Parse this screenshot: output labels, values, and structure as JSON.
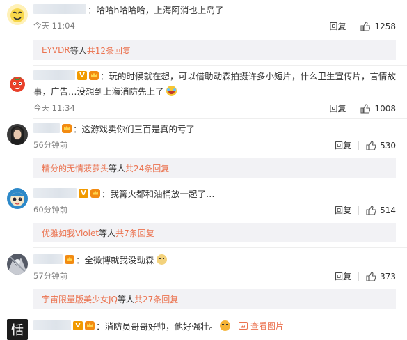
{
  "comments": [
    {
      "text": "：哈哈h哈哈哈，上海阿消也上岛了",
      "time": "今天 11:04",
      "reply_label": "回复",
      "likes": "1258",
      "sub": {
        "user": "EYVDR",
        "mid": " 等人 ",
        "count": "共12条回复"
      }
    },
    {
      "text": "：玩的时候就在想，可以借助动森拍摄许多小短片，什么卫生宣传片，言情故",
      "text2": "事，广告…没想到上海消防先上了",
      "time": "今天 11:34",
      "reply_label": "回复",
      "likes": "1008"
    },
    {
      "text": "：这游戏卖你们三百是真的亏了",
      "time": "56分钟前",
      "reply_label": "回复",
      "likes": "530",
      "sub": {
        "user": "精分的无情菠萝头",
        "mid": " 等人 ",
        "count": "共24条回复"
      }
    },
    {
      "text": "：我篝火都和油桶放一起了…",
      "time": "60分钟前",
      "reply_label": "回复",
      "likes": "514",
      "sub": {
        "user": "优雅如我Violet",
        "mid": " 等人 ",
        "count": "共7条回复"
      }
    },
    {
      "text": "：全微博就我没动森",
      "time": "57分钟前",
      "reply_label": "回复",
      "likes": "373",
      "sub": {
        "user": "宇宙限量版美少女JQ",
        "mid": " 等人 ",
        "count": "共27条回复"
      }
    },
    {
      "text": "：消防员哥哥好帅，他好强壮。",
      "view_pic": "查看图片"
    }
  ],
  "vbadge_text": "V",
  "avatar_text_last": "恬",
  "icons": [
    "v-badge",
    "crown-badge",
    "thumb-up-icon",
    "picture-icon",
    "laugh-emoji",
    "doge-emoji",
    "pout-emoji"
  ]
}
